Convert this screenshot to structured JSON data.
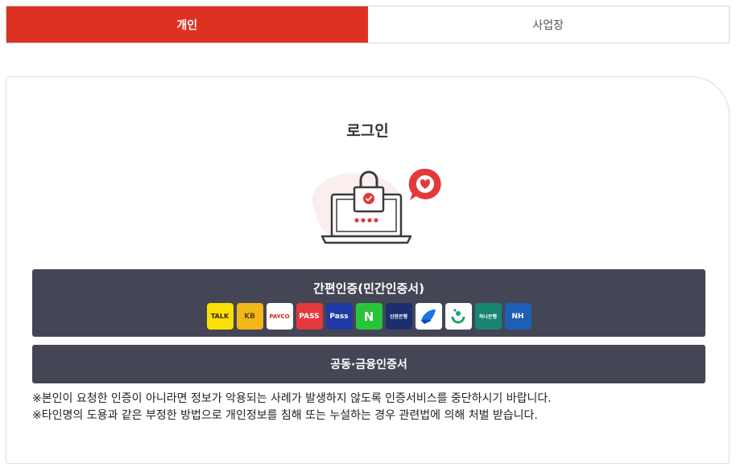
{
  "tabs": [
    {
      "label": "개인",
      "active": true
    },
    {
      "label": "사업장",
      "active": false
    }
  ],
  "login": {
    "title": "로그인"
  },
  "simple_auth": {
    "label": "간편인증(민간인증서)",
    "providers": [
      {
        "name": "kakao-talk",
        "text": "TALK",
        "bg": "#f9e000",
        "fg": "#3a1d1d"
      },
      {
        "name": "kb-bank",
        "text": "KB",
        "bg": "#f3b71a",
        "fg": "#5b4a1c"
      },
      {
        "name": "payco",
        "text": "PAYCO",
        "bg": "#ffffff",
        "fg": "#e02020"
      },
      {
        "name": "pass",
        "text": "PASS",
        "bg": "#e4393c",
        "fg": "#ffffff"
      },
      {
        "name": "samsung-pass",
        "text": "Pass",
        "bg": "#1f3aa6",
        "fg": "#ffffff"
      },
      {
        "name": "naver",
        "text": "N",
        "bg": "#29c43c",
        "fg": "#ffffff"
      },
      {
        "name": "shinhan-bank",
        "text": "신한은행",
        "bg": "#1b2f6e",
        "fg": "#ffffff"
      },
      {
        "name": "toss",
        "text": "",
        "bg": "#ffffff",
        "fg": "#1a73e8"
      },
      {
        "name": "bank-salad",
        "text": "",
        "bg": "#ffffff",
        "fg": "#1aa56f"
      },
      {
        "name": "hana-bank",
        "text": "하나은행",
        "bg": "#188572",
        "fg": "#ffffff"
      },
      {
        "name": "nh-bank",
        "text": "NH",
        "bg": "#1c5fb5",
        "fg": "#ffffff"
      }
    ]
  },
  "joint_auth": {
    "label": "공동·금융인증서"
  },
  "notice": {
    "line1": "※본인이 요청한 인증이 아니라면 정보가 악용되는 사례가 발생하지 않도록 인증서비스를 중단하시기 바랍니다.",
    "line2": "※타인명의 도용과 같은 부정한 방법으로 개인정보를 침해 또는 누설하는 경우 관련법에 의해 처벌 받습니다."
  },
  "colors": {
    "accent": "#dd3223",
    "button_bg": "#444655"
  }
}
